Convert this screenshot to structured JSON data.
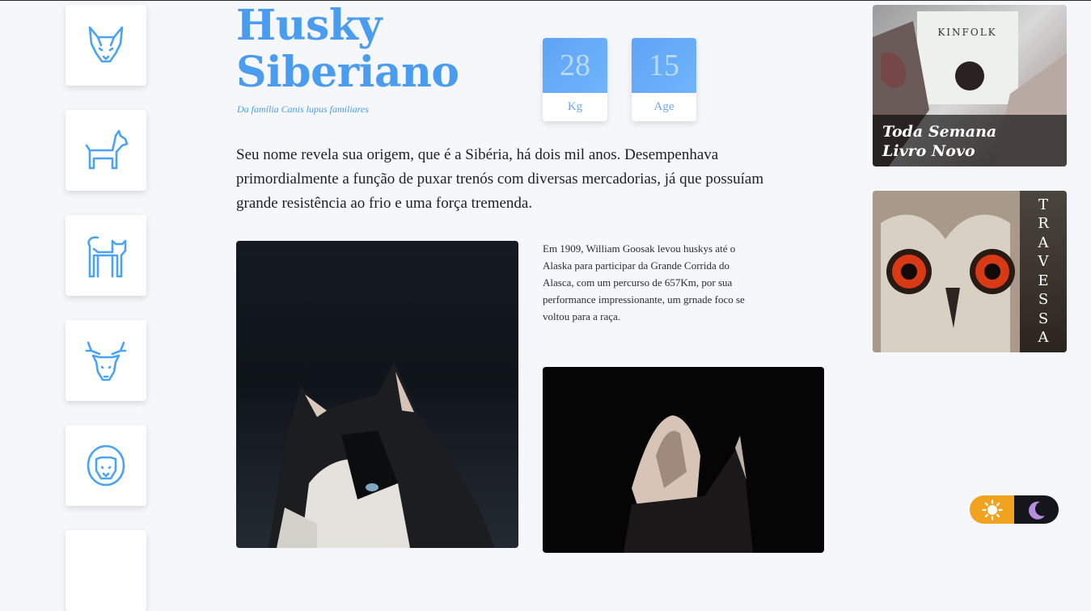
{
  "nav": {
    "items": [
      {
        "icon": "wolf-icon"
      },
      {
        "icon": "dog-icon"
      },
      {
        "icon": "cat-icon"
      },
      {
        "icon": "deer-icon"
      },
      {
        "icon": "lion-icon"
      }
    ]
  },
  "header": {
    "title_line1": "Husky",
    "title_line2": "Siberiano",
    "subtitle": "Da família Canis lupus familiares"
  },
  "stats": {
    "weight_value": "28",
    "weight_label": "Kg",
    "age_value": "15",
    "age_label": "Age"
  },
  "content": {
    "intro": "Seu nome revela sua origem, que é a Sibéria, há dois mil anos. Desempenhava primordialmente a função de puxar trenós com diversas mercadorias, já que possuíam grande resistência ao frio e uma força tremenda.",
    "history": "Em 1909, William Goosak levou huskys até o Alaska para participar da Grande Corrida do Alasca, com um percurso de 657Km, por sua performance impressionante, um grnade foco se voltou para a raça."
  },
  "ads": {
    "ad1_magazine": "KINFOLK",
    "ad1_line1": "Toda Semana",
    "ad1_line2": "Livro Novo",
    "ad2_letters": [
      "T",
      "R",
      "A",
      "V",
      "E",
      "S",
      "S",
      "A"
    ]
  },
  "theme_toggle": {
    "light_icon": "sun-icon",
    "dark_icon": "moon-icon",
    "colors": {
      "light": "#f1a21e",
      "dark": "#15151c",
      "moon": "#b98ce0"
    }
  },
  "colors": {
    "accent": "#4a9cef",
    "background": "#f6f7fb"
  }
}
